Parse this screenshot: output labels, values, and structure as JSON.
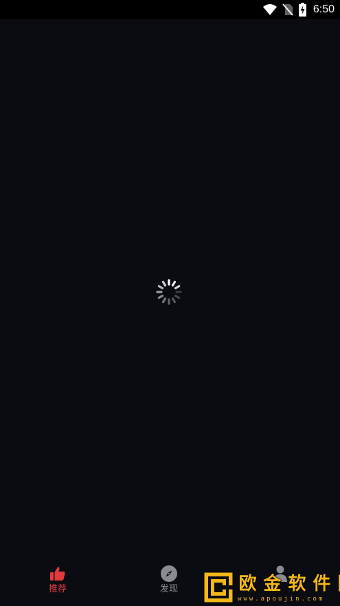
{
  "status_bar": {
    "time": "6:50",
    "icons": [
      "wifi-icon",
      "no-sim-icon",
      "battery-charging-icon"
    ]
  },
  "loading": {
    "icon": "loading-spinner-icon"
  },
  "bottom_nav": {
    "items": [
      {
        "label": "推荐",
        "icon": "thumbs-up-icon",
        "active": true,
        "color": "#e23b3b"
      },
      {
        "label": "发现",
        "icon": "compass-icon",
        "active": false,
        "color": "#8a8b90"
      },
      {
        "label": "",
        "icon": "person-icon",
        "active": false,
        "color": "#8a8b90"
      }
    ]
  },
  "watermark": {
    "title_chars": [
      "欧",
      "金",
      "软",
      "件",
      "园"
    ],
    "subtitle": "www.apoujin.com",
    "color": "#f3b817"
  }
}
